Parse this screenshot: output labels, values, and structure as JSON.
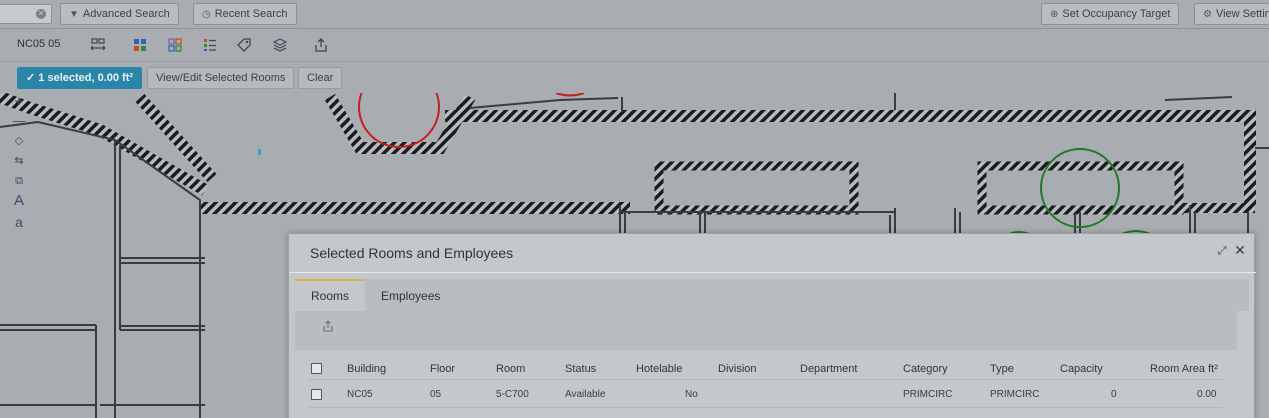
{
  "topbar": {
    "advanced_search": "Advanced Search",
    "recent_search": "Recent Search",
    "set_occupancy_target": "Set Occupancy Target",
    "view_settings": "View Settings"
  },
  "toolbar": {
    "floor_label": "NC05 05"
  },
  "selection": {
    "badge": "1 selected, 0.00 ft²",
    "view_edit": "View/Edit Selected Rooms",
    "clear": "Clear"
  },
  "left_tools": {
    "text_upper": "A",
    "text_lower": "a"
  },
  "dialog": {
    "title": "Selected Rooms and Employees",
    "tabs": [
      {
        "label": "Rooms",
        "active": true
      },
      {
        "label": "Employees",
        "active": false
      }
    ],
    "columns": [
      "Building",
      "Floor",
      "Room",
      "Status",
      "Hotelable",
      "Division",
      "Department",
      "Category",
      "Type",
      "Capacity",
      "Room Area ft²"
    ],
    "rows": [
      {
        "building": "NC05",
        "floor": "05",
        "room": "5-C700",
        "status": "Available",
        "hotelable": "No",
        "division": "",
        "department": "",
        "category": "PRIMCIRC",
        "type": "PRIMCIRC",
        "capacity": "0",
        "area": "0.00"
      }
    ]
  },
  "colors": {
    "accent": "#2a86a8",
    "tab_active": "#d6b24a",
    "circle_red": "#c0221f",
    "circle_green": "#1f7a2a"
  }
}
